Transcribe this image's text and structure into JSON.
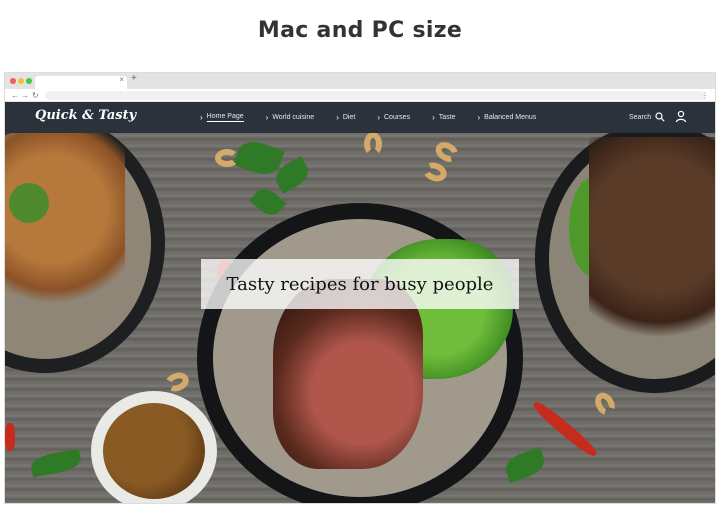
{
  "caption": "Mac and PC size",
  "browser": {
    "close_glyph": "×",
    "new_tab_glyph": "+",
    "back_glyph": "←",
    "forward_glyph": "→",
    "reload_glyph": "↻",
    "menu_glyph": "⋮"
  },
  "site": {
    "logo": "Quick & Tasty",
    "nav": [
      {
        "label": "Home Page",
        "active": true
      },
      {
        "label": "World cuisine"
      },
      {
        "label": "Diet"
      },
      {
        "label": "Courses"
      },
      {
        "label": "Taste"
      },
      {
        "label": "Balanced Menus"
      }
    ],
    "chevron_glyph": "›",
    "search_label": "Search",
    "hero_headline": "Tasty recipes for busy people"
  },
  "colors": {
    "nav_bg": "#2b323b",
    "nav_text": "#ffffff",
    "chili_red": "#c62b1b",
    "herb_green": "#2f7a27"
  },
  "icons": [
    "search-icon",
    "user-icon",
    "chevron-right-icon"
  ]
}
